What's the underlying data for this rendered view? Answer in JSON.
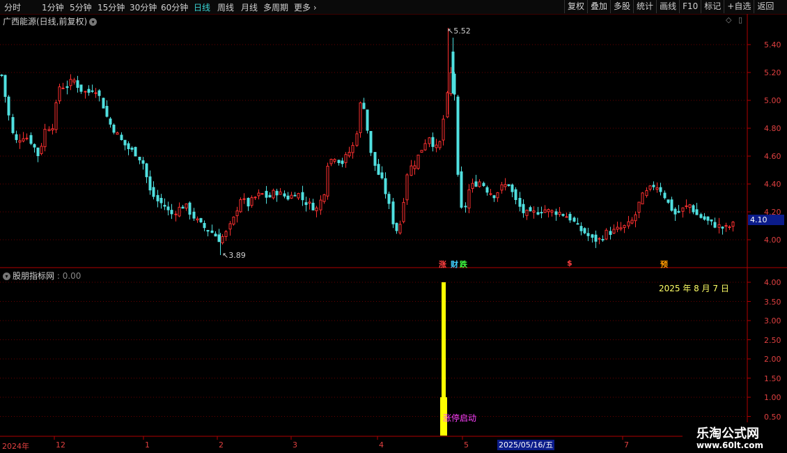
{
  "toolbar": {
    "periods": [
      "分时",
      "1分钟",
      "5分钟",
      "15分钟",
      "30分钟",
      "60分钟",
      "日线",
      "周线",
      "月线",
      "多周期",
      "更多"
    ],
    "active_period": "日线",
    "right_buttons": [
      "复权",
      "叠加",
      "多股",
      "统计",
      "画线",
      "F10",
      "标记",
      "+自选",
      "返回"
    ]
  },
  "main_chart": {
    "title": "广西能源(日线,前复权)",
    "price_axis": [
      "5.40",
      "5.20",
      "5.00",
      "4.80",
      "4.60",
      "4.40",
      "4.20",
      "4.00"
    ],
    "current_price": "4.10",
    "high_label": "5.52",
    "low_label": "3.89",
    "markers": [
      {
        "text": "涨",
        "color": "#ff4040"
      },
      {
        "text": "财",
        "color": "#40d0ff"
      },
      {
        "text": "跌",
        "color": "#40ff40"
      },
      {
        "text": "$",
        "color": "#ff4040"
      },
      {
        "text": "预",
        "color": "#ff9900"
      }
    ]
  },
  "indicator": {
    "title": "股朋指标网",
    "value": "0.00",
    "axis": [
      "4.00",
      "3.50",
      "3.00",
      "2.50",
      "2.00",
      "1.50",
      "1.00",
      "0.50"
    ],
    "date_note": "2025 年 8 月 7 日",
    "signal_text": "涨停启动",
    "bar_values": {
      "outer": 4.0,
      "inner": 1.0
    }
  },
  "x_axis": {
    "labels": [
      "2024年",
      "12",
      "1",
      "2",
      "3",
      "4",
      "5",
      "7"
    ],
    "selected_date": "2025/05/16/五"
  },
  "watermark": {
    "line1": "乐淘公式网",
    "line2": "www.60lt.com"
  },
  "colors": {
    "up": "#ff3030",
    "down": "#50e0e0",
    "grid": "#6a0000",
    "axis": "#b00000",
    "bar": "#ffff00"
  }
}
